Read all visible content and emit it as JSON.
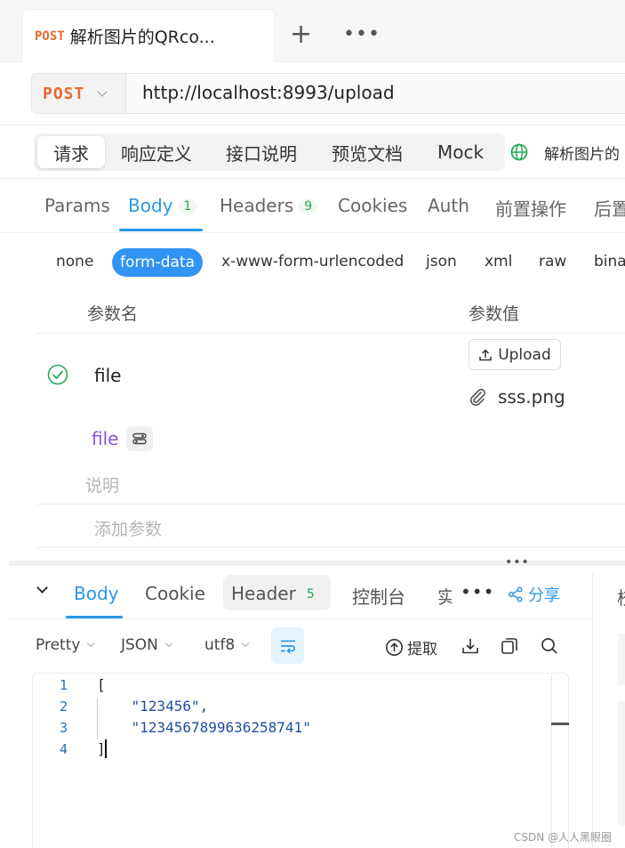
{
  "tabbar": {
    "active_tab": {
      "method": "POST",
      "title": "解析图片的QRco..."
    },
    "plus": "+",
    "more": "•••"
  },
  "request": {
    "method": "POST",
    "url": "http://localhost:8993/upload"
  },
  "segments": {
    "items": [
      "请求",
      "响应定义",
      "接口说明",
      "预览文档",
      "Mock"
    ],
    "active": "请求",
    "api_name": "解析图片的"
  },
  "param_tabs": {
    "params": "Params",
    "body": "Body",
    "body_count": "1",
    "headers": "Headers",
    "headers_count": "9",
    "cookies": "Cookies",
    "auth": "Auth",
    "pre_ops": "前置操作",
    "post_ops": "后置"
  },
  "body_types": {
    "none": "none",
    "form_data": "form-data",
    "urlencoded": "x-www-form-urlencoded",
    "json": "json",
    "xml": "xml",
    "raw": "raw",
    "binary": "bina"
  },
  "params_table": {
    "col_name": "参数名",
    "col_value": "参数值",
    "row": {
      "name": "file",
      "upload_label": "Upload",
      "file_name": "sss.png",
      "type": "file",
      "description_placeholder": "说明"
    },
    "add_param": "添加参数"
  },
  "response": {
    "tabs": {
      "body": "Body",
      "cookie": "Cookie",
      "header": "Header",
      "header_count": "5",
      "console": "控制台",
      "truncated": "实"
    },
    "more": "•••",
    "share": "分享",
    "right_char": "校"
  },
  "toolbar": {
    "format": "Pretty",
    "lang": "JSON",
    "encoding": "utf8",
    "extract": "提取"
  },
  "editor": {
    "line_numbers": [
      "1",
      "2",
      "3",
      "4"
    ],
    "lines": [
      "[",
      "    \"123456\",",
      "    \"1234567899636258741\"",
      "]"
    ]
  },
  "watermark": "CSDN @人人黑眼圈",
  "colors": {
    "accent": "#2a98e6",
    "method": "#e8692c",
    "success": "#2aa85a",
    "type": "#8a56d8"
  }
}
